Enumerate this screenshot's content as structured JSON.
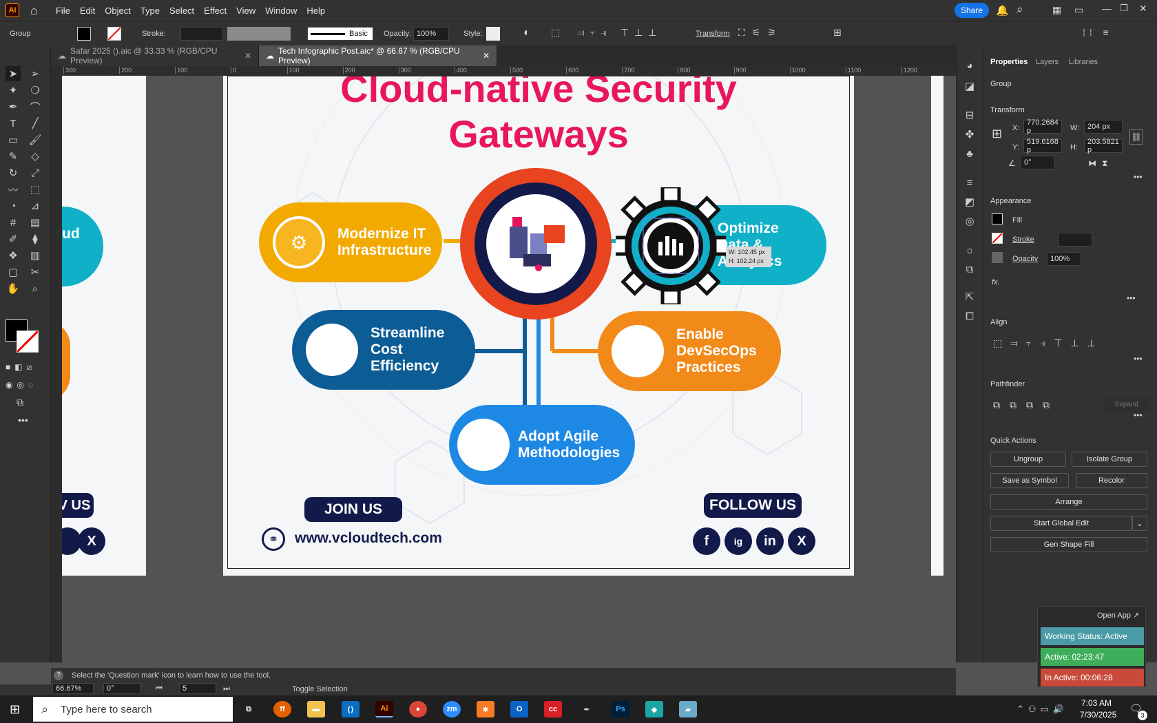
{
  "menubar": {
    "items": [
      "File",
      "Edit",
      "Object",
      "Type",
      "Select",
      "Effect",
      "View",
      "Window",
      "Help"
    ],
    "share": "Share"
  },
  "control": {
    "selection": "Group",
    "stroke_label": "Stroke:",
    "brush": "Basic",
    "opacity_label": "Opacity:",
    "opacity": "100%",
    "style_label": "Style:",
    "transform": "Transform"
  },
  "tabs": [
    {
      "label": "Safar 2025 ().aic @ 33.33 % (RGB/CPU Preview)"
    },
    {
      "label": "Tech Infographic Post.aic* @ 66.67 % (RGB/CPU Preview)"
    }
  ],
  "ruler": {
    "ticks": [
      "300",
      "200",
      "100",
      "0",
      "100",
      "200",
      "300",
      "400",
      "500",
      "600",
      "700",
      "800",
      "900",
      "1000",
      "1100",
      "1200"
    ]
  },
  "artboard": {
    "title_line1": "Cloud-native Security",
    "title_line2": "Gateways",
    "pills": [
      {
        "line1": "Modernize IT",
        "line2": "Infrastructure",
        "line3": ""
      },
      {
        "line1": "Optimize",
        "line2": "Data &",
        "line3": "Analytics"
      },
      {
        "line1": "Streamline",
        "line2": "Cost",
        "line3": "Efficiency"
      },
      {
        "line1": "Enable",
        "line2": "DevSecOps",
        "line3": "Practices"
      },
      {
        "line1": "Adopt Agile",
        "line2": "Methodologies",
        "line3": ""
      }
    ],
    "join": "JOIN US",
    "follow": "FOLLOW US",
    "website": "www.vcloudtech.com",
    "social": [
      "f",
      "ig",
      "in",
      "X"
    ],
    "tooltip_w": "W: 102.45 px",
    "tooltip_h": "H: 102.24 px"
  },
  "left_artboard": {
    "pill_text": "ud",
    "follow": "V US"
  },
  "properties": {
    "tabs": [
      "Properties",
      "Layers",
      "Libraries"
    ],
    "kind": "Group",
    "transform": "Transform",
    "x_label": "X:",
    "x": "770.2684 p",
    "y_label": "Y:",
    "y": "519.6168 p",
    "w_label": "W:",
    "w": "204 px",
    "h_label": "H:",
    "h": "203.5821 p",
    "angle": "0°",
    "appearance": "Appearance",
    "fill": "Fill",
    "stroke": "Stroke",
    "opacity": "Opacity",
    "opacity_val": "100%",
    "fx": "fx.",
    "align": "Align",
    "pathfinder": "Pathfinder",
    "expand": "Expand",
    "quick": "Quick Actions",
    "buttons": [
      "Ungroup",
      "Isolate Group",
      "Save as Symbol",
      "Recolor",
      "Arrange",
      "Start Global Edit",
      "Gen Shape Fill"
    ]
  },
  "status": {
    "hint": "Select the 'Question mark' icon to learn how to use the tool.",
    "zoom": "66.67%",
    "angle": "0°",
    "page": "5",
    "mode": "Toggle Selection"
  },
  "widget": {
    "open": "Open App",
    "working": "Working Status: Active",
    "active": "Active: 02:23:47",
    "inactive": "In Active: 00:06:28",
    "colors": {
      "working": "#4a9aa8",
      "active": "#3fae5a",
      "inactive": "#c94a3a"
    }
  },
  "taskbar": {
    "search": "Type here to search",
    "time": "7:03 AM",
    "date": "7/30/2025",
    "notif": "3"
  },
  "colors": {
    "accent": "#e8175d",
    "yellow": "#f2a900",
    "teal": "#0fb0c8",
    "navy": "#0c5d96",
    "orange": "#f28a1a",
    "blue": "#1e88e5",
    "dark": "#121a4a"
  }
}
